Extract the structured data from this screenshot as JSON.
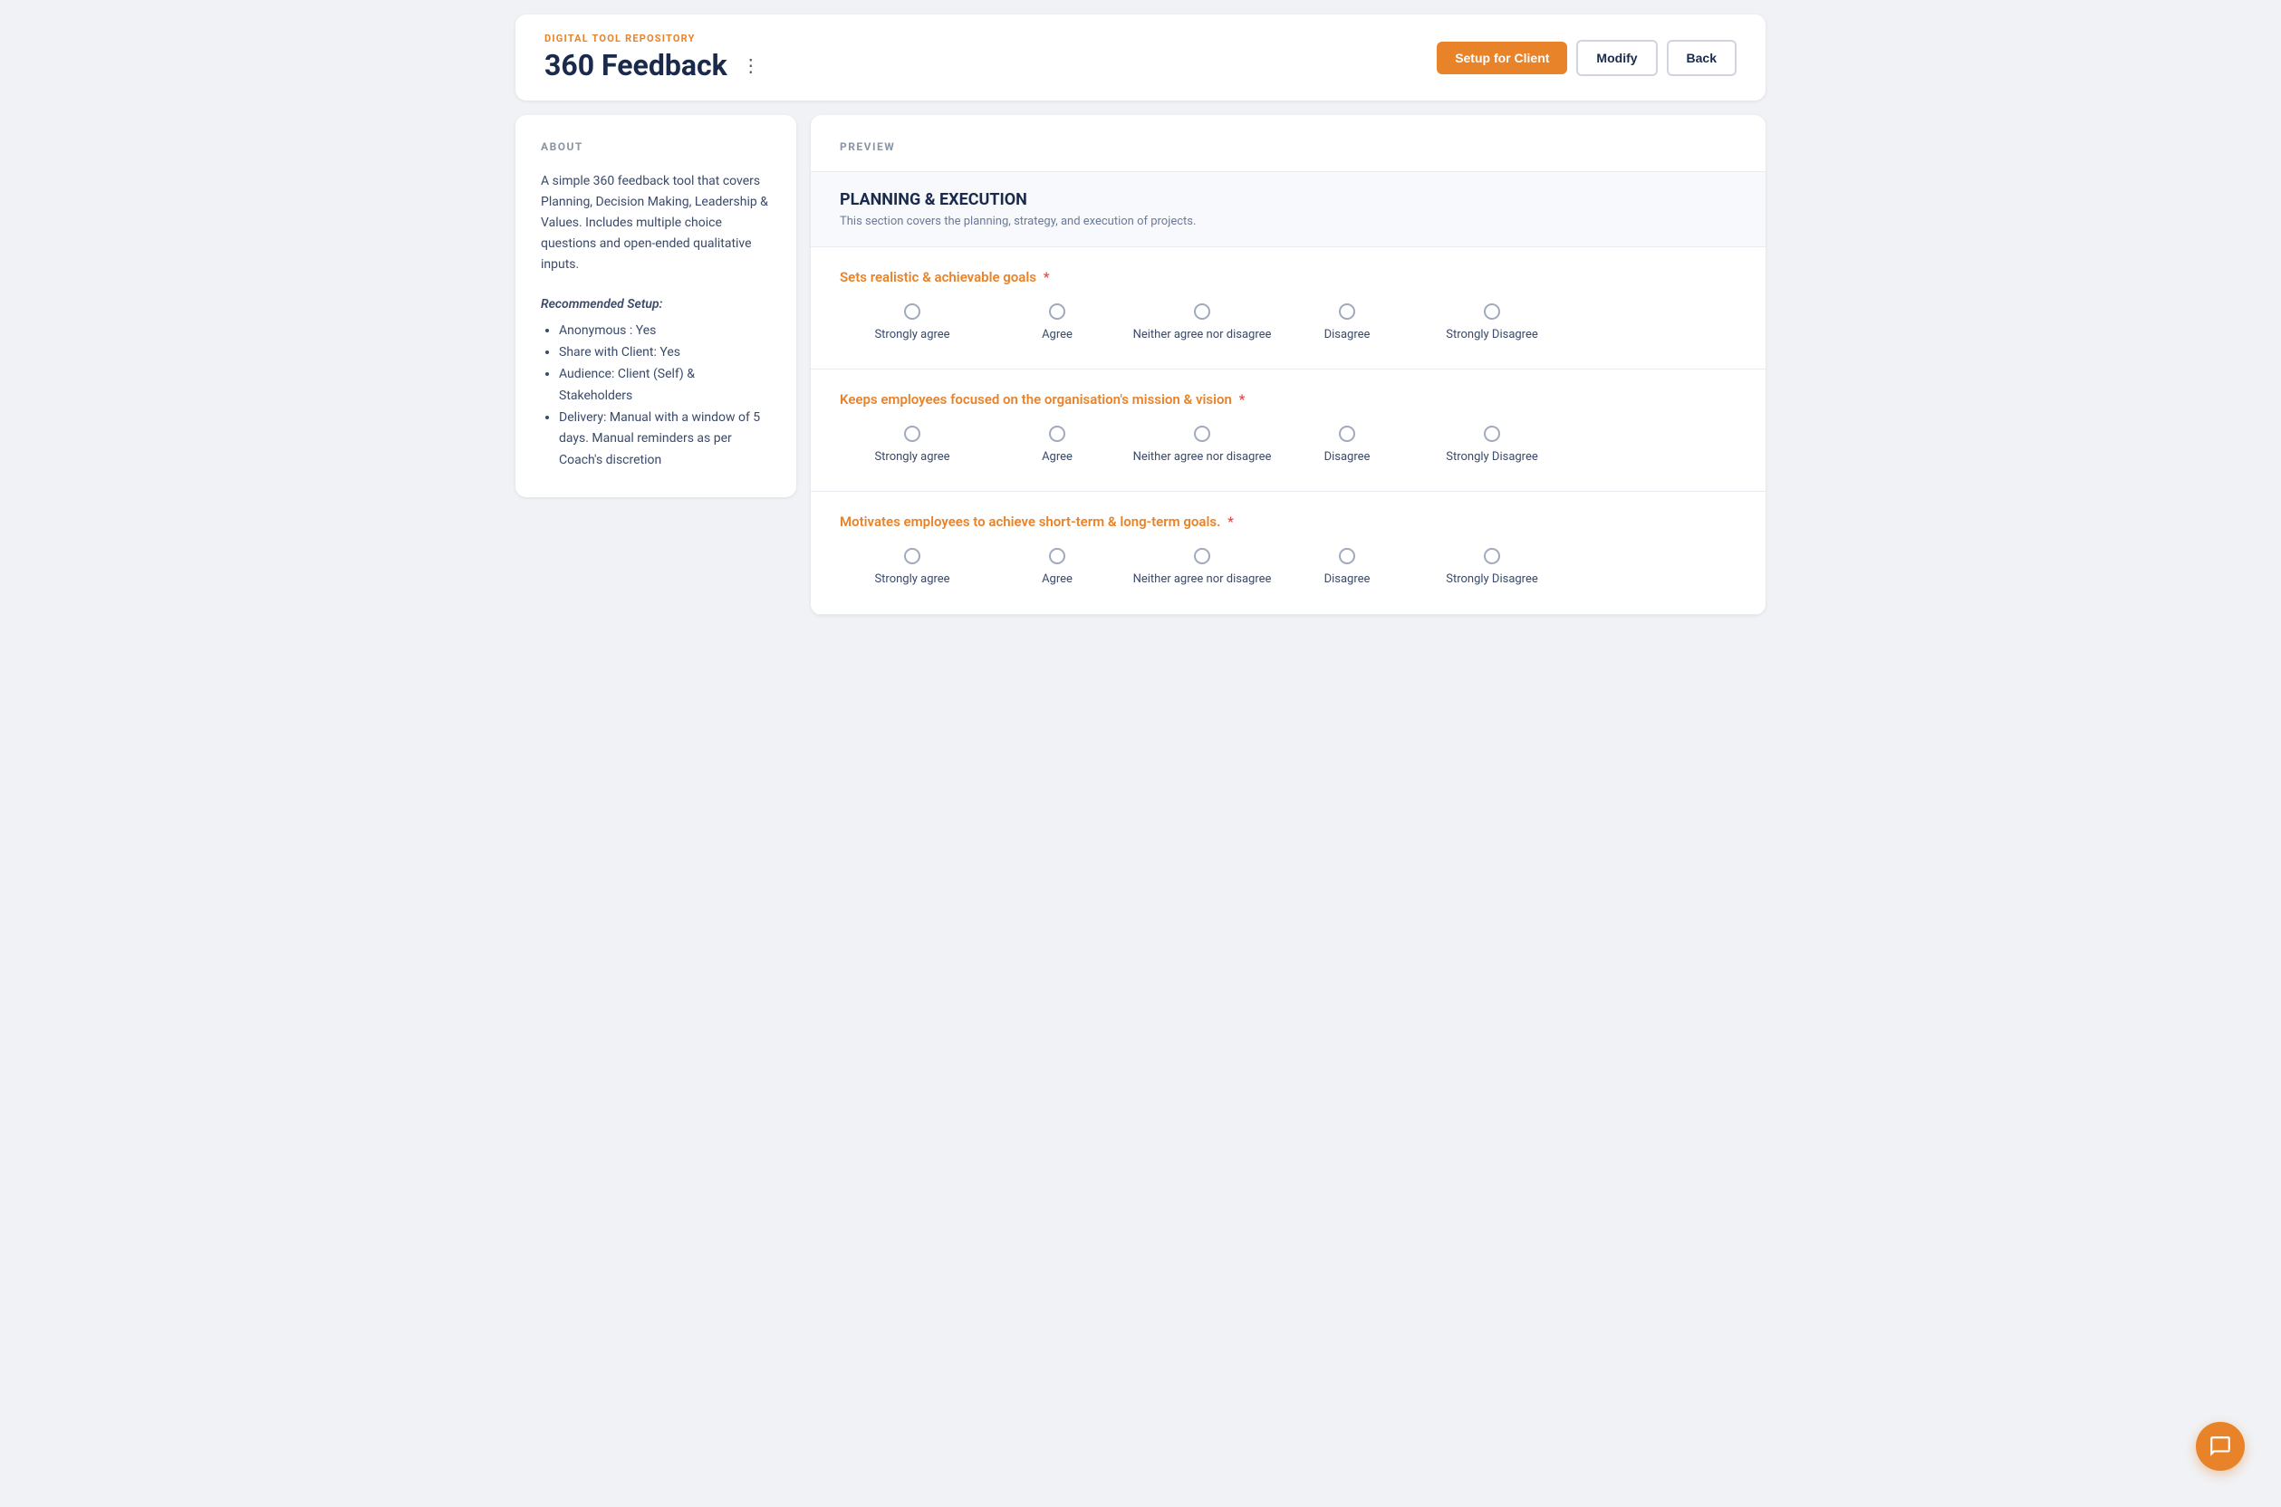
{
  "header": {
    "digital_tool_label": "DIGITAL TOOL REPOSITORY",
    "page_title": "360 Feedback",
    "menu_icon": "⋮",
    "actions": {
      "setup_label": "Setup for Client",
      "modify_label": "Modify",
      "back_label": "Back"
    }
  },
  "about": {
    "section_label": "ABOUT",
    "description": "A simple 360 feedback tool that covers Planning, Decision Making, Leadership & Values. Includes multiple choice questions and open-ended qualitative inputs.",
    "recommended_setup_title": "Recommended Setup:",
    "setup_items": [
      "Anonymous : Yes",
      "Share with Client: Yes",
      "Audience: Client (Self) & Stakeholders",
      "Delivery: Manual with a window of 5 days. Manual reminders as per Coach's discretion"
    ]
  },
  "preview": {
    "section_label": "PREVIEW",
    "planning_section": {
      "title": "PLANNING & EXECUTION",
      "subtitle": "This section covers the planning, strategy, and execution of projects."
    },
    "questions": [
      {
        "text": "Sets realistic & achievable goals",
        "required": true,
        "options": [
          {
            "label": "Strongly agree"
          },
          {
            "label": "Agree"
          },
          {
            "label": "Neither agree nor disagree"
          },
          {
            "label": "Disagree"
          },
          {
            "label": "Strongly Disagree"
          }
        ]
      },
      {
        "text": "Keeps employees focused on the organisation's mission & vision",
        "required": true,
        "options": [
          {
            "label": "Strongly agree"
          },
          {
            "label": "Agree"
          },
          {
            "label": "Neither agree nor disagree"
          },
          {
            "label": "Disagree"
          },
          {
            "label": "Strongly Disagree"
          }
        ]
      },
      {
        "text": "Motivates employees to achieve short-term & long-term goals.",
        "required": true,
        "options": [
          {
            "label": "Strongly agree"
          },
          {
            "label": "Agree"
          },
          {
            "label": "Neither agree nor disagree"
          },
          {
            "label": "Disagree"
          },
          {
            "label": "Strongly Disagree"
          }
        ]
      }
    ]
  }
}
